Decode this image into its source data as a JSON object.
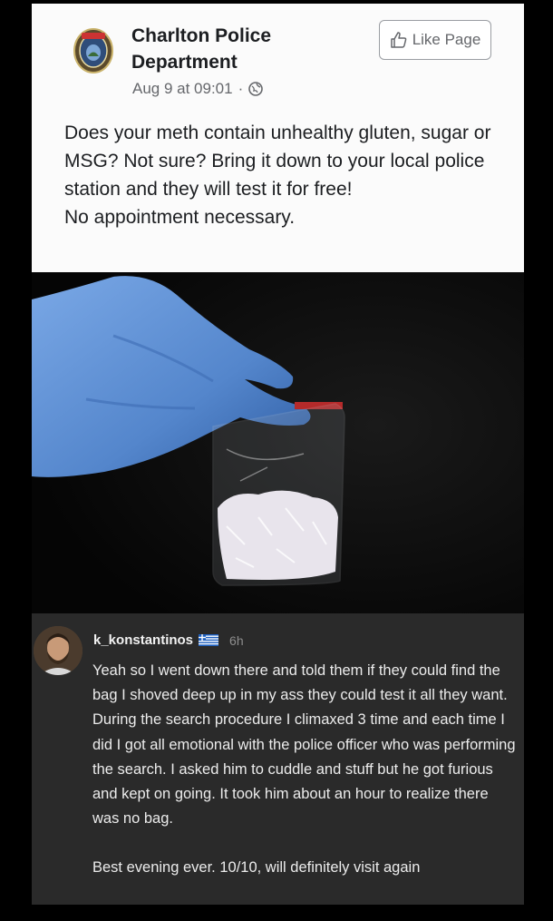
{
  "post": {
    "page_name": "Charlton Police Department",
    "date": "Aug 9 at 09:01",
    "separator": "·",
    "like_button": "Like Page",
    "text_line1": "Does your meth contain unhealthy gluten, sugar or MSG? Not sure? Bring it down to your local police station and they will test it for free!",
    "text_line2": "No appointment necessary."
  },
  "comment": {
    "username": "k_konstantinos",
    "time": "6h",
    "body": "Yeah so I went down there and told them if they could find the bag I shoved deep up in my ass they could test it all they want. During the search procedure I climaxed 3 time and each time I did I got all emotional with the police officer who was performing the search. I asked him to cuddle and stuff but he got furious and kept on going. It took him about an hour to realize there was no bag.",
    "footer": "Best evening ever. 10/10, will definitely visit again"
  },
  "icons": {
    "badge": "police-badge-icon",
    "globe": "globe-icon",
    "like": "thumbs-up-icon",
    "flag": "greek-flag-icon"
  },
  "colors": {
    "post_bg": "#fbfbfb",
    "comment_bg": "#2a2a2a",
    "glove": "#5d8fd4"
  }
}
